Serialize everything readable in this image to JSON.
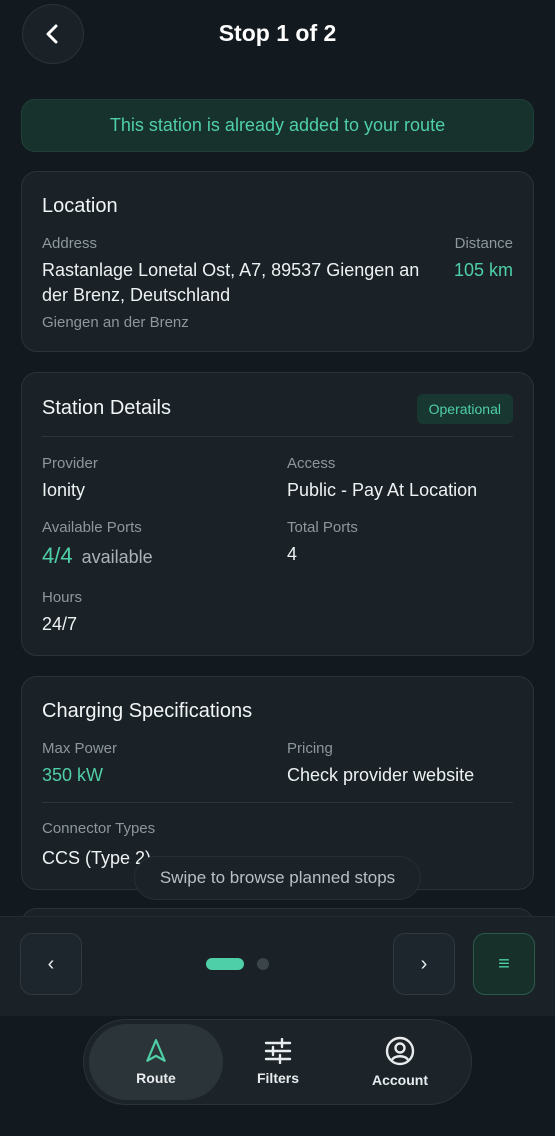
{
  "header": {
    "title": "Stop 1 of 2",
    "back_icon": "chevron-left-icon"
  },
  "banner": {
    "text": "This station is already added to your route"
  },
  "location": {
    "title": "Location",
    "address_label": "Address",
    "address_line1": "Rastanlage Lonetal Ost, A7, 89537 Giengen an",
    "address_line2": "der Brenz, Deutschland",
    "city": "Giengen an der Brenz",
    "distance_label": "Distance",
    "distance_value": "105 km"
  },
  "station": {
    "title": "Station Details",
    "status": "Operational",
    "provider_label": "Provider",
    "provider_value": "Ionity",
    "access_label": "Access",
    "access_value": "Public - Pay At Location",
    "ports_label": "Available Ports",
    "ports_value": "4/4",
    "ports_suffix": "available",
    "total_label": "Total Ports",
    "total_value": "4",
    "hours_label": "Hours",
    "hours_value": "24/7"
  },
  "charging": {
    "title": "Charging Specifications",
    "power_label": "Max Power",
    "power_value": "350 kW",
    "pricing_label": "Pricing",
    "pricing_value": "Check provider website",
    "connector_label": "Connector Types",
    "connector_value": "CCS (Type 2)"
  },
  "toast": {
    "text": "Swipe to browse planned stops"
  },
  "pager": {
    "prev": "‹",
    "next": "›",
    "menu": "≡",
    "current_page": 1,
    "total_pages": 2
  },
  "tabs": [
    {
      "label": "Route",
      "icon": "navigation-arrow-icon",
      "active": true
    },
    {
      "label": "Filters",
      "icon": "sliders-icon",
      "active": false
    },
    {
      "label": "Account",
      "icon": "user-circle-icon",
      "active": false
    }
  ],
  "colors": {
    "accent": "#4fcfa7",
    "background": "#131a1f",
    "card": "#1a2227"
  }
}
